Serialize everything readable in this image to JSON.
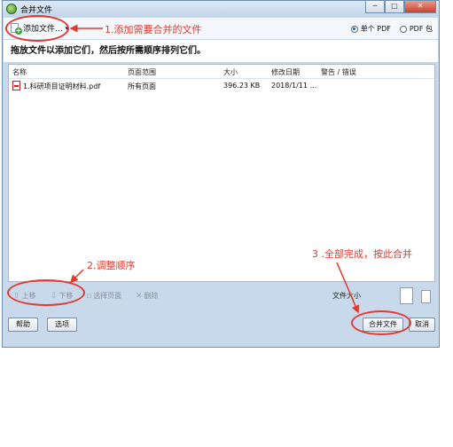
{
  "window": {
    "title": "合并文件",
    "min_glyph": "─",
    "max_glyph": "□",
    "close_glyph": "✕"
  },
  "toolbar": {
    "add_files_label": "添加文件...",
    "dropdown_glyph": "▾",
    "output_options": [
      {
        "label": "单个 PDF",
        "selected": true
      },
      {
        "label": "PDF 包",
        "selected": false
      }
    ]
  },
  "instruction": "拖放文件以添加它们，然后按所需顺序排列它们。",
  "file_list": {
    "columns": [
      "名称",
      "页面范围",
      "大小",
      "修改日期",
      "警告 / 错误"
    ],
    "rows": [
      {
        "name": "1.科研项目证明材料.pdf",
        "page_range": "所有页面",
        "size": "396.23 KB",
        "modified": "2018/1/11 ...",
        "warning": ""
      }
    ]
  },
  "controls": {
    "move_up": "上移",
    "move_down": "下移",
    "select_pages": "选择页面",
    "delete": "删除",
    "file_size_label": "文件大小"
  },
  "buttons": {
    "help": "帮助",
    "options": "选项",
    "merge": "合并文件",
    "cancel": "取消"
  },
  "annotations": {
    "step1": "1.添加需要合并的文件",
    "step2": "2.调整顺序",
    "step3": "3 .全部完成，按此合并"
  },
  "colors": {
    "annotation": "#e23a2e",
    "titlebar": "#c9d9ec"
  }
}
